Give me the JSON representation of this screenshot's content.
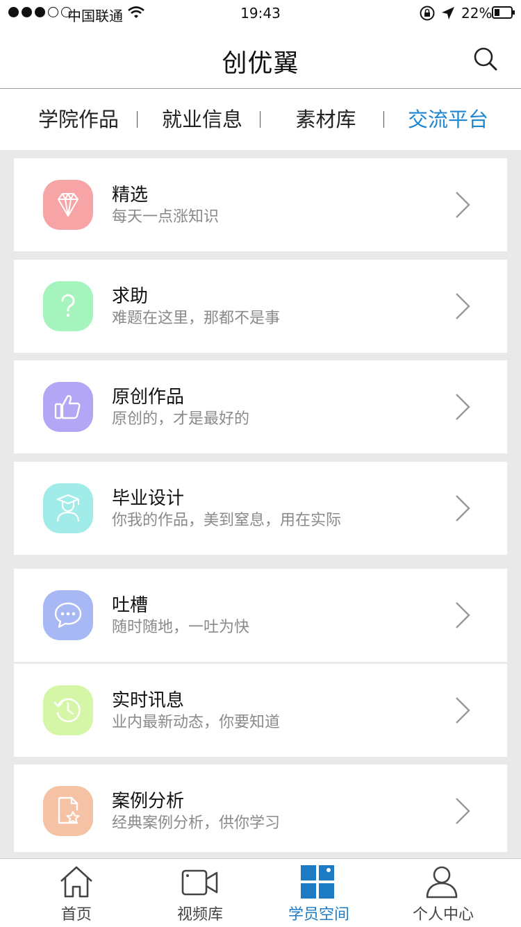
{
  "status_bar": {
    "carrier": "中国联通",
    "time": "19:43",
    "battery": "22%"
  },
  "nav": {
    "title": "创优翼",
    "icon": "search-icon"
  },
  "tabs": [
    {
      "label": "学院作品",
      "active": false
    },
    {
      "label": "就业信息",
      "active": false
    },
    {
      "label": "素材库",
      "active": false
    },
    {
      "label": "交流平台",
      "active": true
    }
  ],
  "colors": {
    "accent": "#1d86d0",
    "background": "#e9e9e9"
  },
  "items": [
    {
      "title": "精选",
      "subtitle": "每天一点涨知识",
      "icon": "diamond-icon",
      "color": "#f7a4a6"
    },
    {
      "title": "求助",
      "subtitle": "难题在这里，那都不是事",
      "icon": "question-icon",
      "color": "#a5f3bd"
    },
    {
      "title": "原创作品",
      "subtitle": "原创的，才是最好的",
      "icon": "thumbs-up-icon",
      "color": "#b3a6f5"
    },
    {
      "title": "毕业设计",
      "subtitle": "你我的作品，美到窒息，用在实际",
      "icon": "graduate-icon",
      "color": "#a1ece8"
    },
    {
      "title": "吐槽",
      "subtitle": "随时随地，一吐为快",
      "icon": "chat-bubble-icon",
      "color": "#a7b8f5"
    },
    {
      "title": "实时讯息",
      "subtitle": "业内最新动态，你要知道",
      "icon": "history-clock-icon",
      "color": "#d4f6a6"
    },
    {
      "title": "案例分析",
      "subtitle": "经典案例分析，供你学习",
      "icon": "document-star-icon",
      "color": "#f6c2a5"
    }
  ],
  "tabbar": [
    {
      "label": "首页",
      "icon": "home-icon",
      "active": false
    },
    {
      "label": "视频库",
      "icon": "video-camera-icon",
      "active": false
    },
    {
      "label": "学员空间",
      "icon": "grid-icon",
      "active": true
    },
    {
      "label": "个人中心",
      "icon": "person-icon",
      "active": false
    }
  ]
}
